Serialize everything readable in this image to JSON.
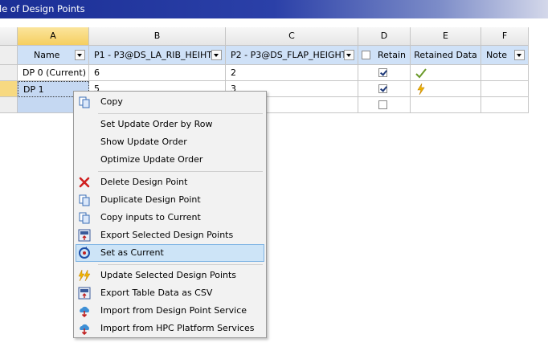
{
  "window": {
    "title": "le of Design Points"
  },
  "columns": [
    {
      "letter": "",
      "header": ""
    },
    {
      "letter": "A",
      "header": "Name"
    },
    {
      "letter": "B",
      "header": "P1 - P3@DS_LA_RIB_HEIHT"
    },
    {
      "letter": "C",
      "header": "P2 - P3@DS_FLAP_HEIGHT"
    },
    {
      "letter": "D",
      "header": "Retain"
    },
    {
      "letter": "E",
      "header": "Retained Data"
    },
    {
      "letter": "F",
      "header": "Note"
    }
  ],
  "rows": [
    {
      "name": "DP 0 (Current)",
      "p1": "6",
      "p2": "2",
      "retain": true,
      "retained_icon": "check-icon"
    },
    {
      "name": "DP 1",
      "p1": "5",
      "p2": "3",
      "retain": true,
      "retained_icon": "lightning-icon"
    },
    {
      "name": "",
      "p1": "",
      "p2": "",
      "retain": false,
      "retained_icon": ""
    }
  ],
  "context_menu": {
    "items": [
      {
        "label": "Copy",
        "icon": "copy-icon"
      },
      {
        "label": "Set Update Order by Row",
        "icon": ""
      },
      {
        "label": "Show Update Order",
        "icon": ""
      },
      {
        "label": "Optimize Update Order",
        "icon": ""
      },
      {
        "label": "Delete Design Point",
        "icon": "delete-icon"
      },
      {
        "label": "Duplicate Design Point",
        "icon": "duplicate-icon"
      },
      {
        "label": "Copy inputs to Current",
        "icon": "copy-inputs-icon"
      },
      {
        "label": "Export Selected Design Points",
        "icon": "export-icon"
      },
      {
        "label": "Set as Current",
        "icon": "set-current-icon"
      },
      {
        "label": "Update Selected Design Points",
        "icon": "update-icon"
      },
      {
        "label": "Export Table Data as CSV",
        "icon": "export-csv-icon"
      },
      {
        "label": "Import from Design Point Service",
        "icon": "cloud-import-icon"
      },
      {
        "label": "Import from HPC Platform Services",
        "icon": "cloud-hpc-icon"
      }
    ],
    "highlighted": "Set as Current"
  },
  "colors": {
    "title_bar": "#1b2f96",
    "selected_column_header": "#f5cf61",
    "selected_cell": "#c5d8f2",
    "menu_highlight": "#cde4f7"
  }
}
